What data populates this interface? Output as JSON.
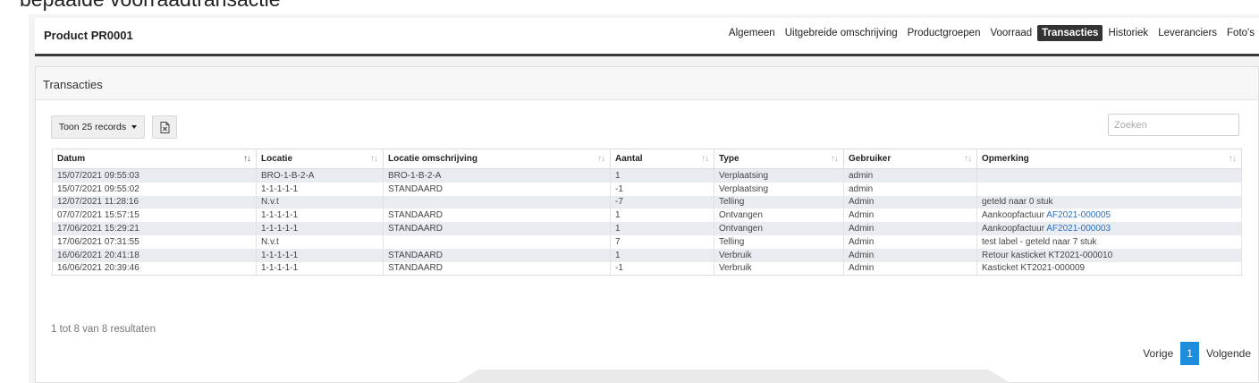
{
  "page": {
    "heading": "bepaalde voorraadtransactie"
  },
  "product": {
    "title": "Product PR0001"
  },
  "tabs": [
    "Algemeen",
    "Uitgebreide omschrijving",
    "Productgroepen",
    "Voorraad",
    "Transacties",
    "Historiek",
    "Leveranciers",
    "Foto's"
  ],
  "active_tab": "Transacties",
  "transactions": {
    "title": "Transacties",
    "records_label": "Toon 25 records",
    "search_placeholder": "Zoeken",
    "columns": [
      "Datum",
      "Locatie",
      "Locatie omschrijving",
      "Aantal",
      "Type",
      "Gebruiker",
      "Opmerking"
    ],
    "rows": [
      [
        "15/07/2021 09:55:03",
        "BRO-1-B-2-A",
        "BRO-1-B-2-A",
        "1",
        "Verplaatsing",
        "admin",
        ""
      ],
      [
        "15/07/2021 09:55:02",
        "1-1-1-1-1",
        "STANDAARD",
        "-1",
        "Verplaatsing",
        "admin",
        ""
      ],
      [
        "12/07/2021 11:28:16",
        "N.v.t",
        "",
        "-7",
        "Telling",
        "Admin",
        "geteld naar 0 stuk"
      ],
      [
        "07/07/2021 15:57:15",
        "1-1-1-1-1",
        "STANDAARD",
        "1",
        "Ontvangen",
        "Admin",
        "Aankoopfactuur AF2021-000005"
      ],
      [
        "17/06/2021 15:29:21",
        "1-1-1-1-1",
        "STANDAARD",
        "1",
        "Ontvangen",
        "Admin",
        "Aankoopfactuur AF2021-000003"
      ],
      [
        "17/06/2021 07:31:55",
        "N.v.t",
        "",
        "7",
        "Telling",
        "Admin",
        "test label - geteld naar 7 stuk"
      ],
      [
        "16/06/2021 20:41:18",
        "1-1-1-1-1",
        "STANDAARD",
        "1",
        "Verbruik",
        "Admin",
        "Retour kasticket KT2021-000010"
      ],
      [
        "16/06/2021 20:39:46",
        "1-1-1-1-1",
        "STANDAARD",
        "-1",
        "Verbruik",
        "Admin",
        "Kasticket KT2021-000009"
      ]
    ],
    "info": "1 tot 8 van 8 resultaten",
    "pagination": {
      "prev": "Vorige",
      "page": "1",
      "next": "Volgende"
    }
  },
  "colors": {
    "active_tab_bg": "#333333",
    "link": "#2a6ebb",
    "page_active": "#1f8dde",
    "row_stripe": "#e8ecf1"
  }
}
